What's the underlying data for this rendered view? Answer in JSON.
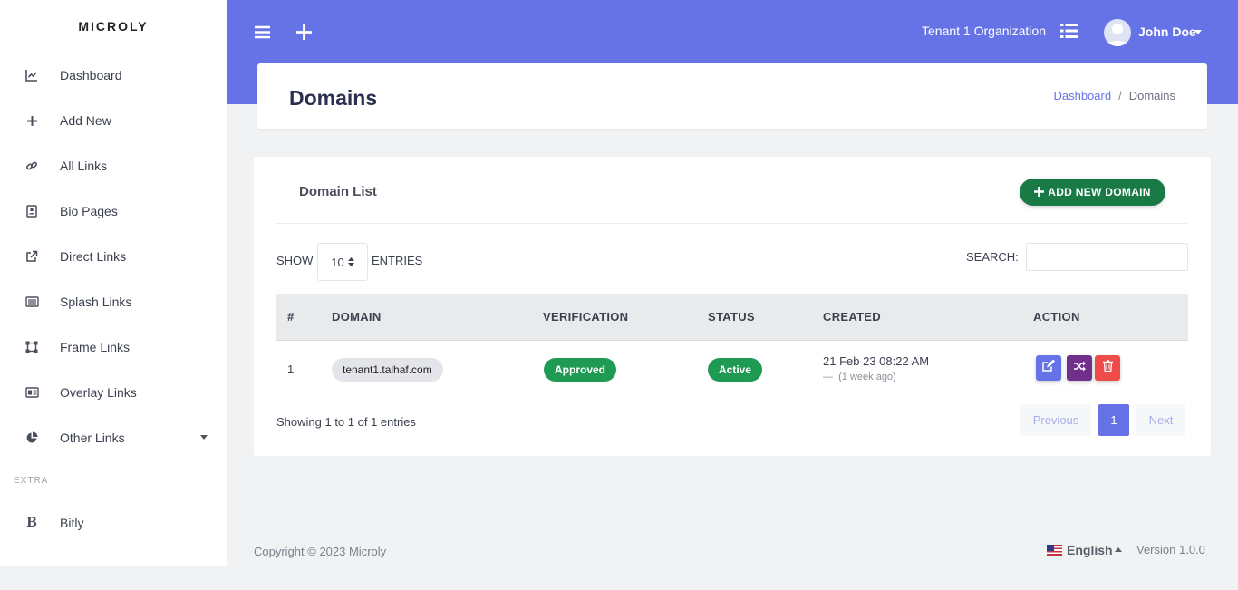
{
  "brand": "MICROLY",
  "sidebar": {
    "items": [
      {
        "label": "Dashboard",
        "icon": "chart-line-icon"
      },
      {
        "label": "Add New",
        "icon": "plus-icon"
      },
      {
        "label": "All Links",
        "icon": "link-icon"
      },
      {
        "label": "Bio Pages",
        "icon": "contact-card-icon"
      },
      {
        "label": "Direct Links",
        "icon": "external-link-icon"
      },
      {
        "label": "Splash Links",
        "icon": "list-card-icon"
      },
      {
        "label": "Frame Links",
        "icon": "frame-icon"
      },
      {
        "label": "Overlay Links",
        "icon": "overlay-icon"
      },
      {
        "label": "Other Links",
        "icon": "pie-chart-icon"
      }
    ],
    "extra_label": "EXTRA",
    "extra_items": [
      {
        "label": "Bitly",
        "icon": "bold-b-icon"
      }
    ]
  },
  "header": {
    "organization": "Tenant 1 Organization",
    "user_name": "John Doe"
  },
  "page": {
    "title": "Domains",
    "breadcrumb": {
      "home": "Dashboard",
      "current": "Domains"
    }
  },
  "domain_list": {
    "title": "Domain List",
    "add_button": "ADD NEW DOMAIN",
    "show_label": "SHOW",
    "page_length": "10",
    "entries_label": "ENTRIES",
    "search_label": "SEARCH:",
    "columns": [
      "#",
      "DOMAIN",
      "VERIFICATION",
      "STATUS",
      "CREATED",
      "ACTION"
    ],
    "rows": [
      {
        "index": "1",
        "domain": "tenant1.talhaf.com",
        "verification": "Approved",
        "status": "Active",
        "created": "21 Feb 23 08:22 AM",
        "created_ago": "(1 week ago)"
      }
    ],
    "info": "Showing 1 to 1 of 1 entries",
    "pagination": {
      "previous": "Previous",
      "current": "1",
      "next": "Next"
    }
  },
  "footer": {
    "copyright": "Copyright © 2023 Microly",
    "language": "English",
    "version": "Version 1.0.0"
  },
  "colors": {
    "primary": "#6673e6",
    "success": "#1f9a52",
    "add_button": "#1a7a46",
    "edit_button": "#6673e6",
    "shuffle_button": "#6f2f8a",
    "delete_button": "#ef4b4b"
  }
}
